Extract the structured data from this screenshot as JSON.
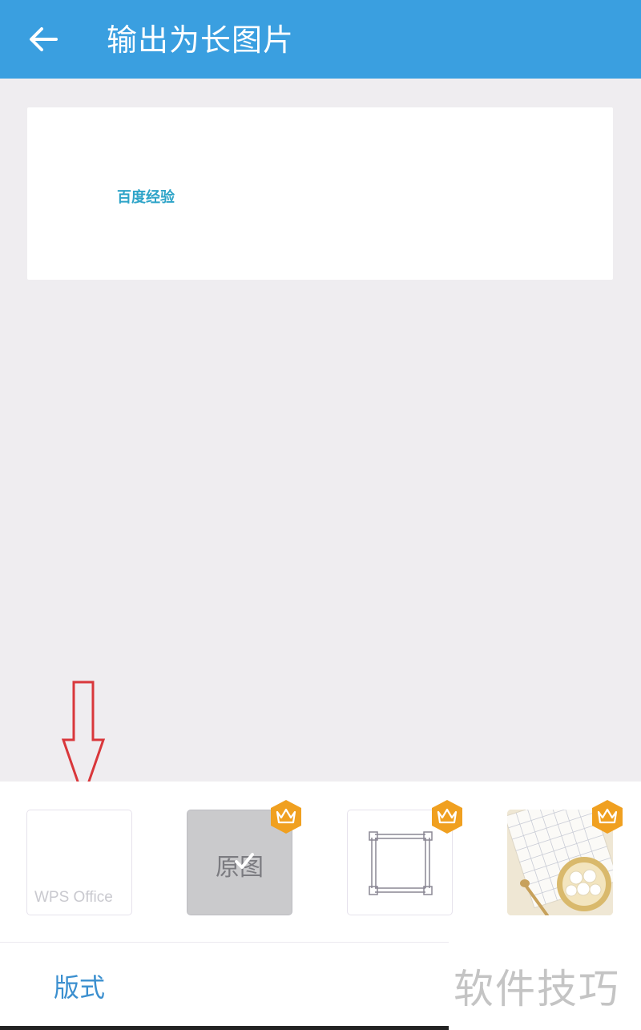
{
  "header": {
    "title": "输出为长图片"
  },
  "preview": {
    "text": "百度经验"
  },
  "templates": {
    "wps_label": "WPS Office",
    "original_label": "原图"
  },
  "tabs": {
    "format_label": "版式"
  },
  "watermark": "软件技巧",
  "colors": {
    "header_bg": "#3a9fe0",
    "accent": "#3b8fcf",
    "crown_badge": "#f0a020",
    "annotation_arrow": "#d9373b"
  }
}
